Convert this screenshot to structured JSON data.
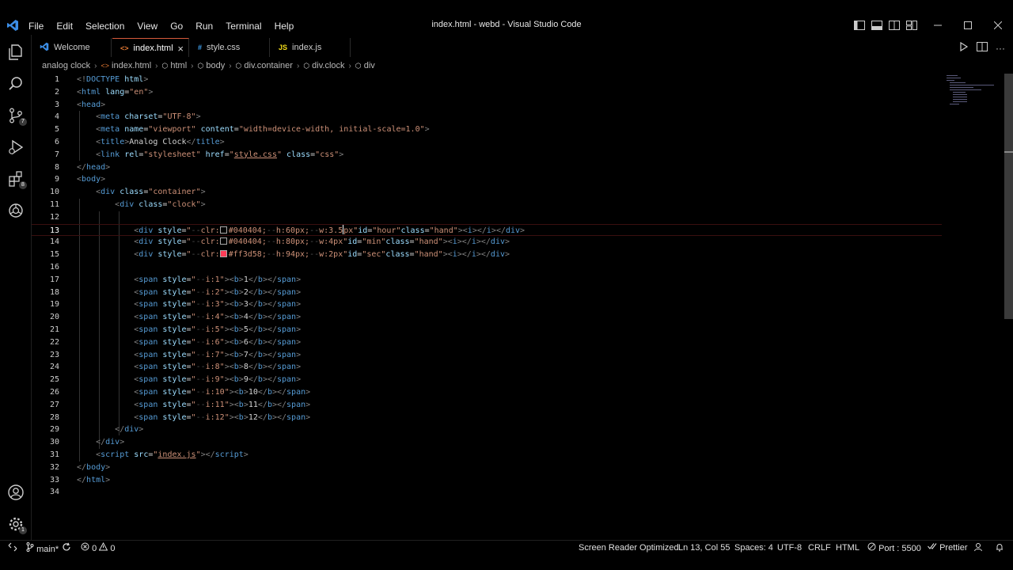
{
  "app": {
    "window_title": "index.html - webd - Visual Studio Code",
    "menu": [
      "File",
      "Edit",
      "Selection",
      "View",
      "Go",
      "Run",
      "Terminal",
      "Help"
    ]
  },
  "activity_bar": {
    "source_control_badge": "7",
    "extensions_badge": "8",
    "settings_badge": "1"
  },
  "tabs": [
    {
      "label": "Welcome",
      "icon": "vscode-icon",
      "active": false
    },
    {
      "label": "index.html",
      "icon": "html-icon",
      "active": true
    },
    {
      "label": "style.css",
      "icon": "css-icon",
      "active": false
    },
    {
      "label": "index.js",
      "icon": "js-icon",
      "active": false
    }
  ],
  "tab_icons": {
    "html": "<>",
    "css": "#",
    "js": "JS"
  },
  "breadcrumb": [
    "analog clock",
    "index.html",
    "html",
    "body",
    "div.container",
    "div.clock",
    "div"
  ],
  "editor": {
    "current_line": 13,
    "line_numbers": [
      "1",
      "2",
      "3",
      "4",
      "5",
      "6",
      "7",
      "8",
      "9",
      "10",
      "11",
      "12",
      "13",
      "14",
      "15",
      "16",
      "17",
      "18",
      "19",
      "20",
      "21",
      "22",
      "23",
      "24",
      "25",
      "26",
      "27",
      "28",
      "29",
      "30",
      "31",
      "32",
      "33",
      "34"
    ]
  },
  "status_bar": {
    "branch": "main*",
    "errors": "0",
    "warnings": "0",
    "screen_reader": "Screen Reader Optimized",
    "position": "Ln 13, Col 55",
    "spaces": "Spaces: 4",
    "encoding": "UTF-8",
    "eol": "CRLF",
    "language": "HTML",
    "port": "Port : 5500",
    "prettier": "Prettier"
  },
  "colors": {
    "accent": "#3c8ee6",
    "active_tab_border": "#d75a3b",
    "swatch_dark": "#040404",
    "swatch_red": "#ff3d58"
  }
}
